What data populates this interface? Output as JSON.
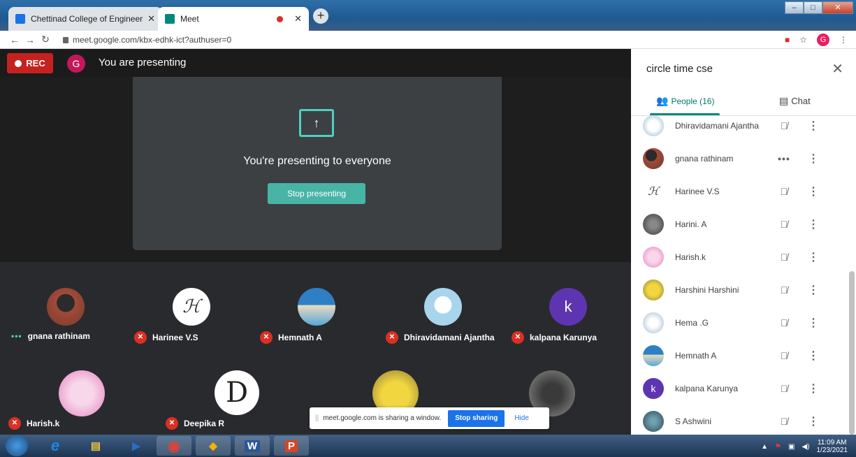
{
  "browser": {
    "tabs": [
      {
        "title": "Chettinad College of Engineering",
        "favicon_color": "#1a73e8"
      },
      {
        "title": "Meet",
        "favicon_color": "#00897b"
      }
    ],
    "url": "meet.google.com/kbx-edhk-ict?authuser=0",
    "profile_initial": "G"
  },
  "meet": {
    "rec_label": "REC",
    "presenter_initial": "G",
    "presenting_label": "You are presenting",
    "presenting_message": "You're presenting to everyone",
    "stop_presenting_label": "Stop presenting",
    "tiles": [
      {
        "name": "gnana rathinam",
        "status": "speaking",
        "color": "#7b3b2a"
      },
      {
        "name": "Harinee V.S",
        "status": "muted",
        "color": "#ffffff",
        "letter": "ℋ"
      },
      {
        "name": "Hemnath A",
        "status": "muted",
        "color": "#5aa6d6"
      },
      {
        "name": "Dhiravidamani Ajantha",
        "status": "muted",
        "color": "#a8d4ec"
      },
      {
        "name": "kalpana Karunya",
        "status": "muted",
        "color": "#5e35b1",
        "letter": "k"
      },
      {
        "name": "Harish.k",
        "status": "muted",
        "color": "#e47fc0"
      },
      {
        "name": "Deepika R",
        "status": "muted",
        "color": "#ffffff",
        "letter": "D"
      },
      {
        "name": "",
        "status": "none",
        "color": "#c8b03a"
      },
      {
        "name": "",
        "status": "none",
        "color": "#8f8f8f"
      }
    ],
    "share_bar": {
      "message": "meet.google.com is sharing a window.",
      "stop_label": "Stop sharing",
      "hide_label": "Hide"
    }
  },
  "panel": {
    "title": "circle time cse",
    "people_tab": "People (16)",
    "chat_tab": "Chat",
    "participants": [
      {
        "name": "Dhiravidamani Ajantha",
        "status": "muted",
        "color": "#8fb6cf"
      },
      {
        "name": "gnana rathinam",
        "status": "speaking",
        "color": "#6d3b2a"
      },
      {
        "name": "Harinee V.S",
        "status": "muted",
        "color": "#ffffff",
        "letter": "ℋ"
      },
      {
        "name": "Harini. A",
        "status": "muted",
        "color": "#4a4a4a"
      },
      {
        "name": "Harish.k",
        "status": "muted",
        "color": "#e47fc0"
      },
      {
        "name": "Harshini Harshini",
        "status": "muted",
        "color": "#c8b03a"
      },
      {
        "name": "Hema .G",
        "status": "muted",
        "color": "#9fb9d0"
      },
      {
        "name": "Hemnath A",
        "status": "muted",
        "color": "#5aa6d6"
      },
      {
        "name": "kalpana Karunya",
        "status": "muted",
        "color": "#5e35b1",
        "letter": "k"
      },
      {
        "name": "S Ashwini",
        "status": "muted",
        "color": "#2d4a55"
      }
    ]
  },
  "taskbar": {
    "apps": [
      {
        "name": "internet-explorer",
        "glyph": "e",
        "color": "#1e88e5"
      },
      {
        "name": "file-explorer",
        "glyph": "▤",
        "color": "#f0c040"
      },
      {
        "name": "media-player",
        "glyph": "▶",
        "color": "#2b6cc4"
      },
      {
        "name": "chrome",
        "glyph": "◉",
        "color": "#db4437"
      },
      {
        "name": "security-center",
        "glyph": "◆",
        "color": "#f4b400"
      },
      {
        "name": "word",
        "glyph": "W",
        "color": "#2b579a"
      },
      {
        "name": "powerpoint",
        "glyph": "P",
        "color": "#d24726"
      }
    ],
    "time": "11:09 AM",
    "date": "1/23/2021"
  }
}
